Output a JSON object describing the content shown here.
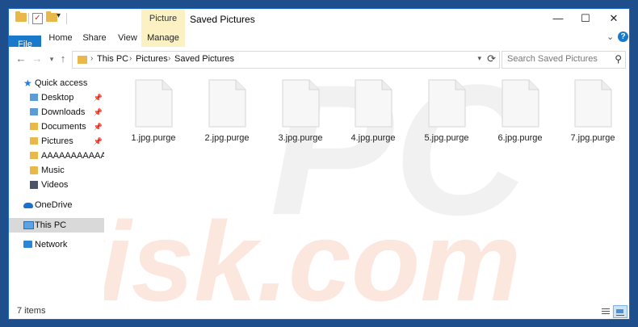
{
  "window": {
    "title": "Saved Pictures",
    "contextual_tab": "Picture Tools",
    "controls": {
      "minimize": "—",
      "maximize": "☐",
      "close": "✕"
    }
  },
  "ribbon": {
    "tabs": [
      "File",
      "Home",
      "Share",
      "View",
      "Manage"
    ],
    "expand_glyph": "⌄",
    "help_glyph": "?"
  },
  "address": {
    "crumbs": [
      "This PC",
      "Pictures",
      "Saved Pictures"
    ],
    "separator": "›"
  },
  "search": {
    "placeholder": "Search Saved Pictures"
  },
  "navpane": {
    "items": [
      {
        "label": "Quick access",
        "icon": "star-icon"
      },
      {
        "label": "Desktop",
        "icon": "desktop-folder-icon",
        "pinned": true
      },
      {
        "label": "Downloads",
        "icon": "downloads-folder-icon",
        "pinned": true
      },
      {
        "label": "Documents",
        "icon": "documents-folder-icon",
        "pinned": true
      },
      {
        "label": "Pictures",
        "icon": "pictures-folder-icon",
        "pinned": true
      },
      {
        "label": "AAAAAAAAAAAAA",
        "icon": "folder-icon"
      },
      {
        "label": "Music",
        "icon": "music-folder-icon"
      },
      {
        "label": "Videos",
        "icon": "videos-folder-icon"
      },
      {
        "label": "OneDrive",
        "icon": "cloud-icon"
      },
      {
        "label": "This PC",
        "icon": "computer-icon",
        "selected": true
      },
      {
        "label": "Network",
        "icon": "network-icon"
      }
    ]
  },
  "files": [
    {
      "name": "1.jpg.purge"
    },
    {
      "name": "2.jpg.purge"
    },
    {
      "name": "3.jpg.purge"
    },
    {
      "name": "4.jpg.purge"
    },
    {
      "name": "5.jpg.purge"
    },
    {
      "name": "6.jpg.purge"
    },
    {
      "name": "7.jpg.purge"
    }
  ],
  "watermark": {
    "line1": "PC",
    "line2": "risk.com"
  },
  "status": {
    "item_count": "7 items"
  },
  "colors": {
    "accent": "#1979ca",
    "contextual": "#fbf1c2",
    "frame": "#1e4e8c"
  }
}
